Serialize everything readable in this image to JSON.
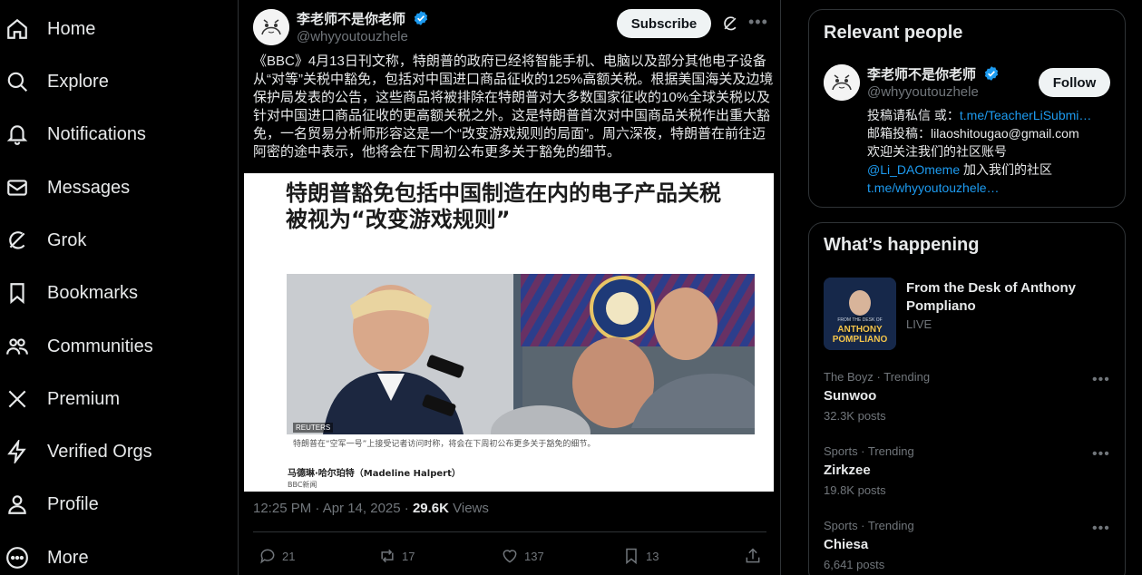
{
  "nav": {
    "items": [
      {
        "label": "Home",
        "icon": "home-icon"
      },
      {
        "label": "Explore",
        "icon": "search-icon"
      },
      {
        "label": "Notifications",
        "icon": "bell-icon"
      },
      {
        "label": "Messages",
        "icon": "envelope-icon"
      },
      {
        "label": "Grok",
        "icon": "grok-icon"
      },
      {
        "label": "Bookmarks",
        "icon": "bookmark-icon"
      },
      {
        "label": "Communities",
        "icon": "communities-icon"
      },
      {
        "label": "Premium",
        "icon": "x-logo-icon"
      },
      {
        "label": "Verified Orgs",
        "icon": "lightning-icon"
      },
      {
        "label": "Profile",
        "icon": "person-icon"
      },
      {
        "label": "More",
        "icon": "more-circle-icon"
      }
    ]
  },
  "tweet": {
    "author_name": "李老师不是你老师",
    "author_handle": "@whyyoutouzhele",
    "subscribe_label": "Subscribe",
    "text": "《BBC》4月13日刊文称，特朗普的政府已经将智能手机、电脑以及部分其他电子设备从“对等”关税中豁免，包括对中国进口商品征收的125%高额关税。根据美国海关及边境保护局发表的公告，这些商品将被排除在特朗普对大多数国家征收的10%全球关税以及针对中国进口商品征收的更高额关税之外。这是特朗普首次对中国商品关税作出重大豁免，一名贸易分析师形容这是一个“改变游戏规则的局面”。周六深夜，特朗普在前往迈阿密的途中表示，他将会在下周初公布更多关于豁免的细节。",
    "media": {
      "headline": "特朗普豁免包括中国制造在内的电子产品关税 被视为“改变游戏规则”",
      "photo_credit": "REUTERS",
      "caption": "特朗普在“空军一号”上接受记者访问时称，将会在下周初公布更多关于豁免的细节。",
      "byline": "马德琳·哈尔珀特（Madeline Halpert）",
      "source": "BBC新闻"
    },
    "timestamp": "12:25 PM · Apr 14, 2025 · ",
    "views_count": "29.6K",
    "views_label": " Views",
    "actions": {
      "replies": "21",
      "reposts": "17",
      "likes": "137",
      "bookmarks": "13"
    }
  },
  "relevant_people": {
    "title": "Relevant people",
    "name": "李老师不是你老师",
    "handle": "@whyyoutouzhele",
    "follow_label": "Follow",
    "bio_line1_prefix": "投稿请私信 或：",
    "bio_line1_link": "t.me/TeacherLiSubmi…",
    "bio_line2": "邮箱投稿：lilaoshitougao@gmail.com",
    "bio_line3": "欢迎关注我们的社区账号",
    "bio_line4_link": "@Li_DAOmeme",
    "bio_line4_suffix": " 加入我们的社区",
    "bio_line5_link": "t.me/whyyoutouzhele…"
  },
  "whats_happening": {
    "title": "What’s happening",
    "live": {
      "title": "From the Desk of Anthony Pompliano",
      "tag": "LIVE",
      "thumb_text_1": "FROM THE DESK OF",
      "thumb_text_2": "ANTHONY",
      "thumb_text_3": "POMPLIANO"
    },
    "trends": [
      {
        "context": "The Boyz · Trending",
        "name": "Sunwoo",
        "count": "32.3K posts"
      },
      {
        "context": "Sports · Trending",
        "name": "Zirkzee",
        "count": "19.8K posts"
      },
      {
        "context": "Sports · Trending",
        "name": "Chiesa",
        "count": "6,641 posts"
      }
    ]
  },
  "colors": {
    "background": "#000000",
    "text": "#e7e9ea",
    "muted": "#71767b",
    "link": "#1d9bf0",
    "border": "#2f3336",
    "verified": "#1d9bf0"
  }
}
